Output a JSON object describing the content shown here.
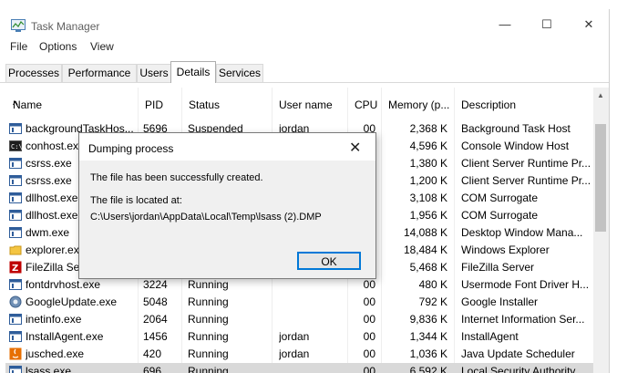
{
  "window": {
    "title": "Task Manager",
    "minimize": "—",
    "maximize": "☐",
    "close": "✕"
  },
  "menu": [
    "File",
    "Options",
    "View"
  ],
  "tabs": [
    "Processes",
    "Performance",
    "Users",
    "Details",
    "Services"
  ],
  "active_tab": "Details",
  "columns": [
    "Name",
    "PID",
    "Status",
    "User name",
    "CPU",
    "Memory (p...",
    "Description"
  ],
  "rows": [
    {
      "name": "backgroundTaskHos...",
      "pid": "5696",
      "status": "Suspended",
      "user": "jordan",
      "cpu": "00",
      "mem": "2,368 K",
      "desc": "Background Task Host",
      "icon": "window-icon"
    },
    {
      "name": "conhost.exe",
      "pid": "",
      "status": "",
      "user": "",
      "cpu": "",
      "mem": "4,596 K",
      "desc": "Console Window Host",
      "icon": "console-icon"
    },
    {
      "name": "csrss.exe",
      "pid": "",
      "status": "",
      "user": "",
      "cpu": "",
      "mem": "1,380 K",
      "desc": "Client Server Runtime Pr...",
      "icon": "window-icon"
    },
    {
      "name": "csrss.exe",
      "pid": "",
      "status": "",
      "user": "",
      "cpu": "",
      "mem": "1,200 K",
      "desc": "Client Server Runtime Pr...",
      "icon": "window-icon"
    },
    {
      "name": "dllhost.exe",
      "pid": "",
      "status": "",
      "user": "",
      "cpu": "",
      "mem": "3,108 K",
      "desc": "COM Surrogate",
      "icon": "window-icon"
    },
    {
      "name": "dllhost.exe",
      "pid": "",
      "status": "",
      "user": "",
      "cpu": "",
      "mem": "1,956 K",
      "desc": "COM Surrogate",
      "icon": "window-icon"
    },
    {
      "name": "dwm.exe",
      "pid": "",
      "status": "",
      "user": "",
      "cpu": "",
      "mem": "14,088 K",
      "desc": "Desktop Window Mana...",
      "icon": "window-icon"
    },
    {
      "name": "explorer.exe",
      "pid": "",
      "status": "",
      "user": "",
      "cpu": "",
      "mem": "18,484 K",
      "desc": "Windows Explorer",
      "icon": "folder-icon"
    },
    {
      "name": "FileZilla Ser",
      "pid": "",
      "status": "",
      "user": "",
      "cpu": "",
      "mem": "5,468 K",
      "desc": "FileZilla Server",
      "icon": "filezilla-icon"
    },
    {
      "name": "fontdrvhost.exe",
      "pid": "3224",
      "status": "Running",
      "user": "",
      "cpu": "00",
      "mem": "480 K",
      "desc": "Usermode Font Driver H...",
      "icon": "window-icon"
    },
    {
      "name": "GoogleUpdate.exe",
      "pid": "5048",
      "status": "Running",
      "user": "",
      "cpu": "00",
      "mem": "792 K",
      "desc": "Google Installer",
      "icon": "google-update-icon"
    },
    {
      "name": "inetinfo.exe",
      "pid": "2064",
      "status": "Running",
      "user": "",
      "cpu": "00",
      "mem": "9,836 K",
      "desc": "Internet Information Ser...",
      "icon": "window-icon"
    },
    {
      "name": "InstallAgent.exe",
      "pid": "1456",
      "status": "Running",
      "user": "jordan",
      "cpu": "00",
      "mem": "1,344 K",
      "desc": "InstallAgent",
      "icon": "window-icon"
    },
    {
      "name": "jusched.exe",
      "pid": "420",
      "status": "Running",
      "user": "jordan",
      "cpu": "00",
      "mem": "1,036 K",
      "desc": "Java Update Scheduler",
      "icon": "java-icon"
    },
    {
      "name": "lsass.exe",
      "pid": "696",
      "status": "Running",
      "user": "",
      "cpu": "00",
      "mem": "6,592 K",
      "desc": "Local Security Authority...",
      "icon": "window-icon",
      "selected": true
    }
  ],
  "dialog": {
    "title": "Dumping process",
    "close": "✕",
    "message": "The file has been successfully created.",
    "location_label": "The file is located at:",
    "path": "C:\\Users\\jordan\\AppData\\Local\\Temp\\lsass (2).DMP",
    "ok_label": "OK"
  },
  "colors": {
    "accent": "#0078d7",
    "selected_row": "#d9d9d9",
    "dialog_bg": "#f0f0f0"
  }
}
